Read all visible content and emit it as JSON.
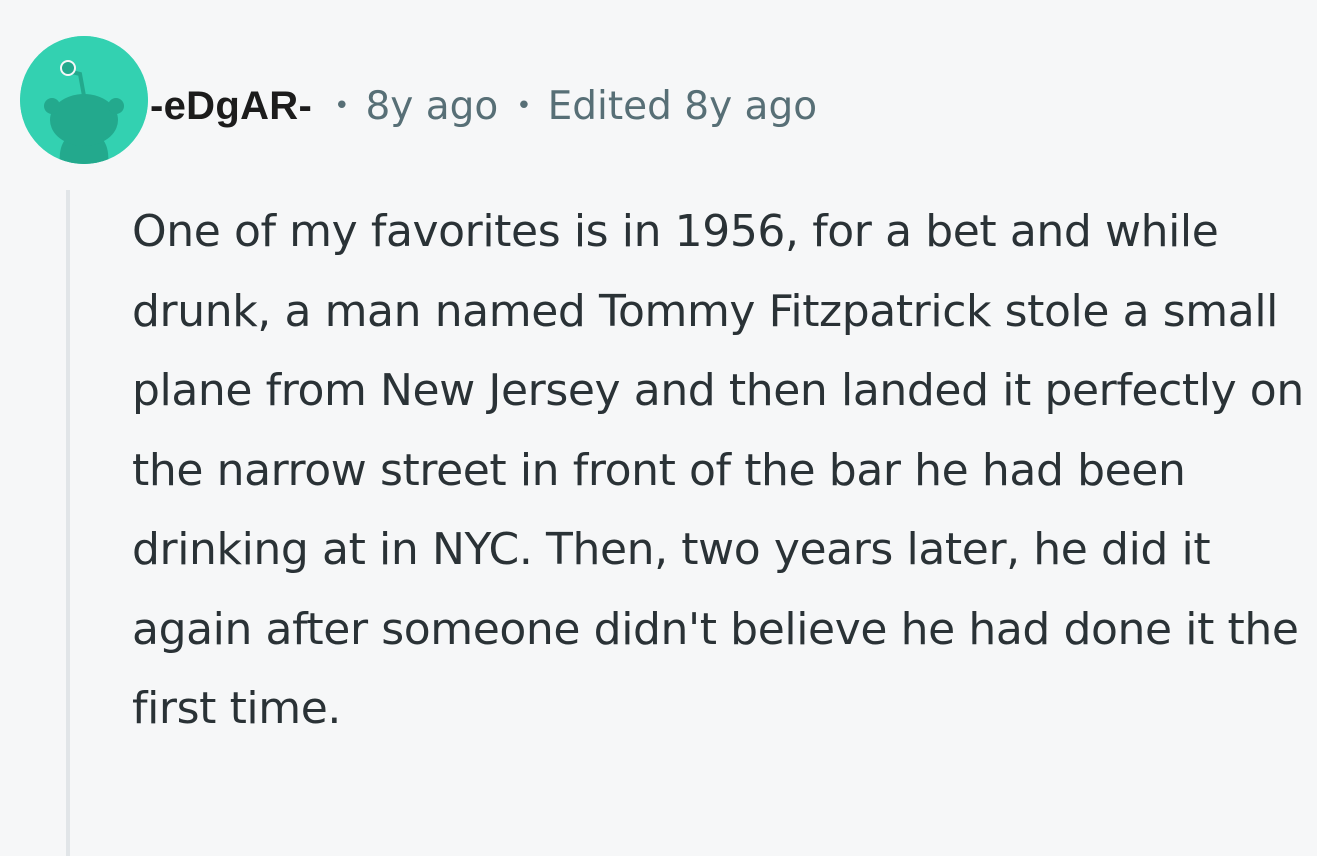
{
  "comment": {
    "author": "-eDgAR-",
    "separator": "•",
    "posted": "8y ago",
    "edited": "Edited 8y ago",
    "avatar": {
      "icon": "reddit-snoo-avatar-icon",
      "background_color": "#33d1b1"
    },
    "body": "One of my favorites is in 1956, for a bet and while drunk, a man named Tommy Fitzpatrick stole a small plane from New Jersey and then landed it perfectly on the narrow street in front of the bar he had been drinking at in NYC. Then, two years later, he did it again after someone didn't believe he had done it the first time."
  },
  "colors": {
    "background": "#f6f7f8",
    "username": "#1c1c1c",
    "meta_text": "#576f76",
    "body_text": "#2a3236",
    "thread_line": "#e1e5e8"
  }
}
